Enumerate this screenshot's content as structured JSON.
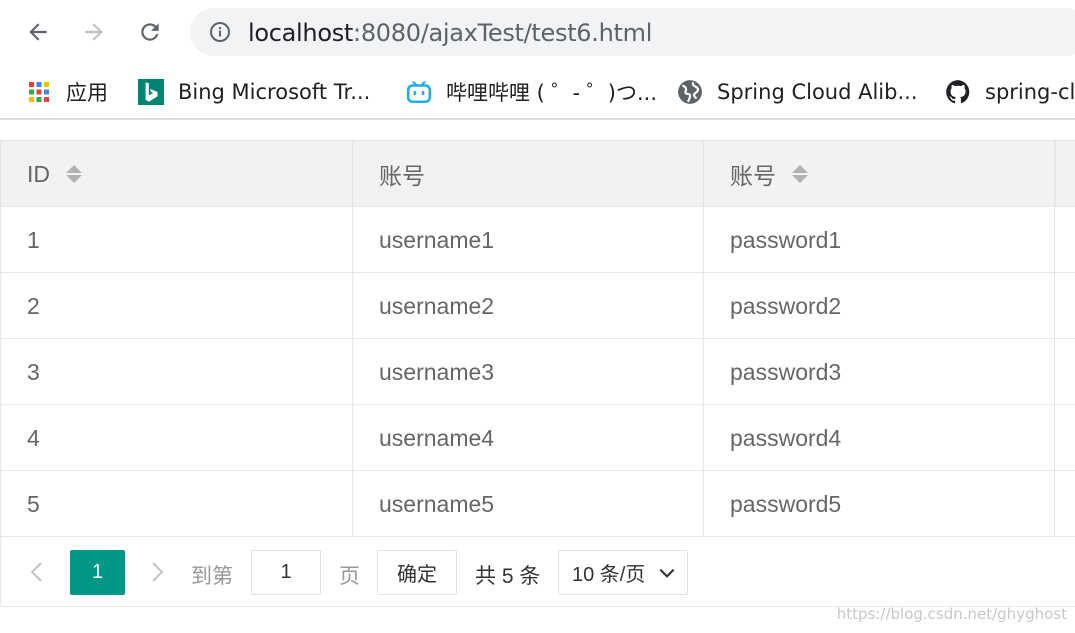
{
  "browser": {
    "url_host": "localhost",
    "url_rest": ":8080/ajaxTest/test6.html",
    "bookmarks": [
      {
        "label": "应用",
        "icon": "apps-grid-icon"
      },
      {
        "label": "Bing Microsoft Tr...",
        "icon": "bing-icon",
        "color": "#008373"
      },
      {
        "label": "哔哩哔哩 ( ゜- ゜)つ...",
        "icon": "bilibili-icon",
        "color": "#23ade5"
      },
      {
        "label": "Spring Cloud Alib...",
        "icon": "globe-icon"
      },
      {
        "label": "spring-cl",
        "icon": "github-icon"
      }
    ]
  },
  "table": {
    "columns": [
      {
        "label": "ID",
        "sortable": true
      },
      {
        "label": "账号",
        "sortable": false
      },
      {
        "label": "账号",
        "sortable": true
      }
    ],
    "rows": [
      [
        "1",
        "username1",
        "password1"
      ],
      [
        "2",
        "username2",
        "password2"
      ],
      [
        "3",
        "username3",
        "password3"
      ],
      [
        "4",
        "username4",
        "password4"
      ],
      [
        "5",
        "username5",
        "password5"
      ]
    ]
  },
  "pager": {
    "current_page": "1",
    "goto_prefix": "到第",
    "goto_value": "1",
    "goto_suffix": "页",
    "confirm_label": "确定",
    "total_label": "共 5 条",
    "page_size_label": "10 条/页",
    "accent_color": "#009688"
  },
  "watermark": "https://blog.csdn.net/ghyghost"
}
